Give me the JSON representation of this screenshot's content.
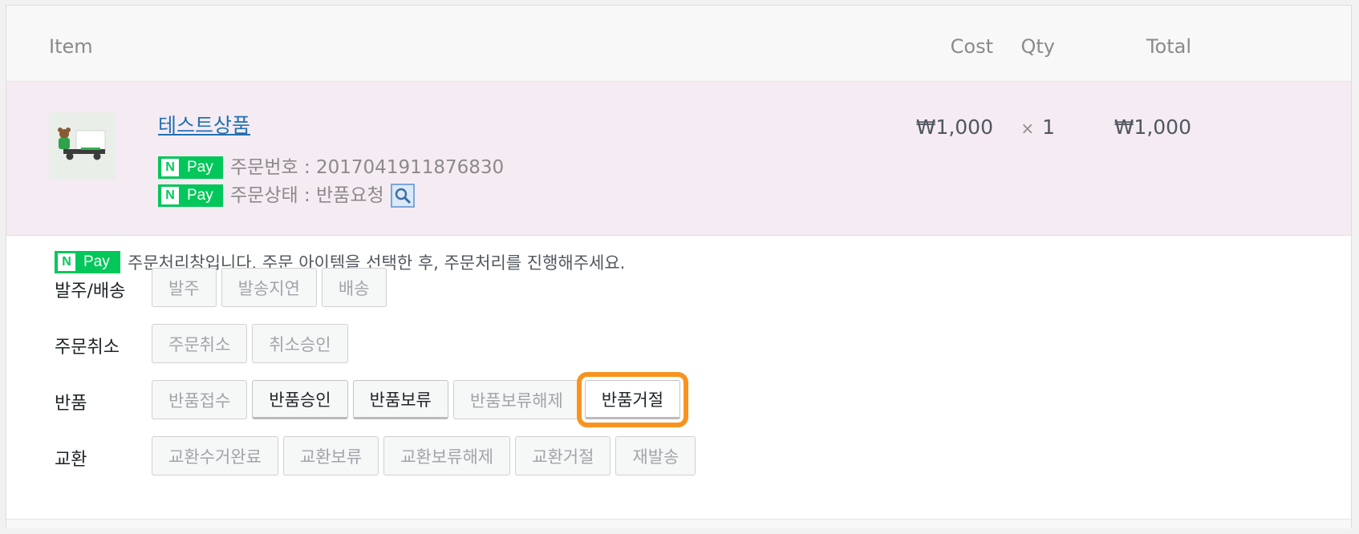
{
  "table": {
    "headers": {
      "item": "Item",
      "cost": "Cost",
      "qty": "Qty",
      "total": "Total"
    }
  },
  "item": {
    "name": "테스트상품",
    "order_number_text": "주문번호 : 2017041911876830",
    "order_status_text": "주문상태 : 반품요청",
    "cost": "₩1,000",
    "qty_symbol": "×",
    "qty": "1",
    "total": "₩1,000"
  },
  "npay": {
    "n": "N",
    "pay": "Pay",
    "color": "#03c75a"
  },
  "process": {
    "notice": "주문처리창입니다. 주문 아이템을 선택한 후, 주문처리를 진행해주세요.",
    "groups": [
      {
        "label": "발주/배송",
        "buttons": [
          "발주",
          "발송지연",
          "배송"
        ]
      },
      {
        "label": "주문취소",
        "buttons": [
          "주문취소",
          "취소승인"
        ]
      },
      {
        "label": "반품",
        "buttons": [
          "반품접수",
          "반품승인",
          "반품보류",
          "반품보류해제",
          "반품거절"
        ]
      },
      {
        "label": "교환",
        "buttons": [
          "교환수거완료",
          "교환보류",
          "교환보류해제",
          "교환거절",
          "재발송"
        ]
      }
    ],
    "highlight_color": "#f7931e"
  }
}
